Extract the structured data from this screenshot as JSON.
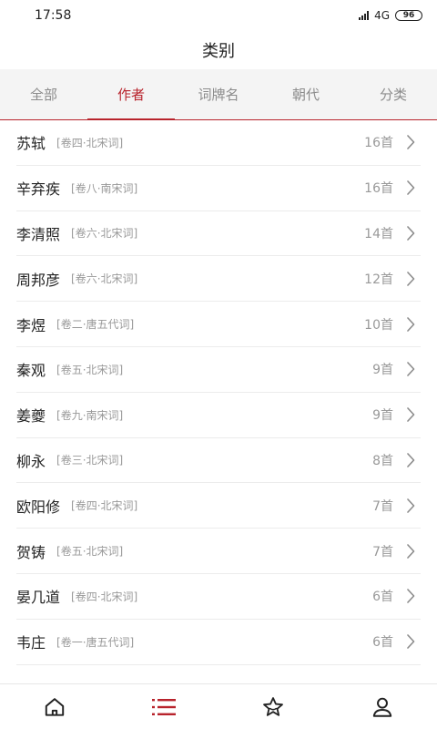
{
  "status": {
    "time": "17:58",
    "network": "4G",
    "battery": "96"
  },
  "header": {
    "title": "类别"
  },
  "tabs": [
    {
      "label": "全部",
      "active": false
    },
    {
      "label": "作者",
      "active": true
    },
    {
      "label": "词牌名",
      "active": false
    },
    {
      "label": "朝代",
      "active": false
    },
    {
      "label": "分类",
      "active": false
    }
  ],
  "authors": [
    {
      "name": "苏轼",
      "tag": "[卷四·北宋词]",
      "count": "16首"
    },
    {
      "name": "辛弃疾",
      "tag": "[卷八·南宋词]",
      "count": "16首"
    },
    {
      "name": "李清照",
      "tag": "[卷六·北宋词]",
      "count": "14首"
    },
    {
      "name": "周邦彦",
      "tag": "[卷六·北宋词]",
      "count": "12首"
    },
    {
      "name": "李煜",
      "tag": "[卷二·唐五代词]",
      "count": "10首"
    },
    {
      "name": "秦观",
      "tag": "[卷五·北宋词]",
      "count": "9首"
    },
    {
      "name": "姜夔",
      "tag": "[卷九·南宋词]",
      "count": "9首"
    },
    {
      "name": "柳永",
      "tag": "[卷三·北宋词]",
      "count": "8首"
    },
    {
      "name": "欧阳修",
      "tag": "[卷四·北宋词]",
      "count": "7首"
    },
    {
      "name": "贺铸",
      "tag": "[卷五·北宋词]",
      "count": "7首"
    },
    {
      "name": "晏几道",
      "tag": "[卷四·北宋词]",
      "count": "6首"
    },
    {
      "name": "韦庄",
      "tag": "[卷一·唐五代词]",
      "count": "6首"
    }
  ],
  "colors": {
    "accent": "#b8232c",
    "text": "#222222",
    "muted": "#999999",
    "tab_bg": "#f4f4f4"
  },
  "bottom_nav": [
    {
      "icon": "home-icon",
      "active": false
    },
    {
      "icon": "list-icon",
      "active": true
    },
    {
      "icon": "star-icon",
      "active": false
    },
    {
      "icon": "user-icon",
      "active": false
    }
  ]
}
